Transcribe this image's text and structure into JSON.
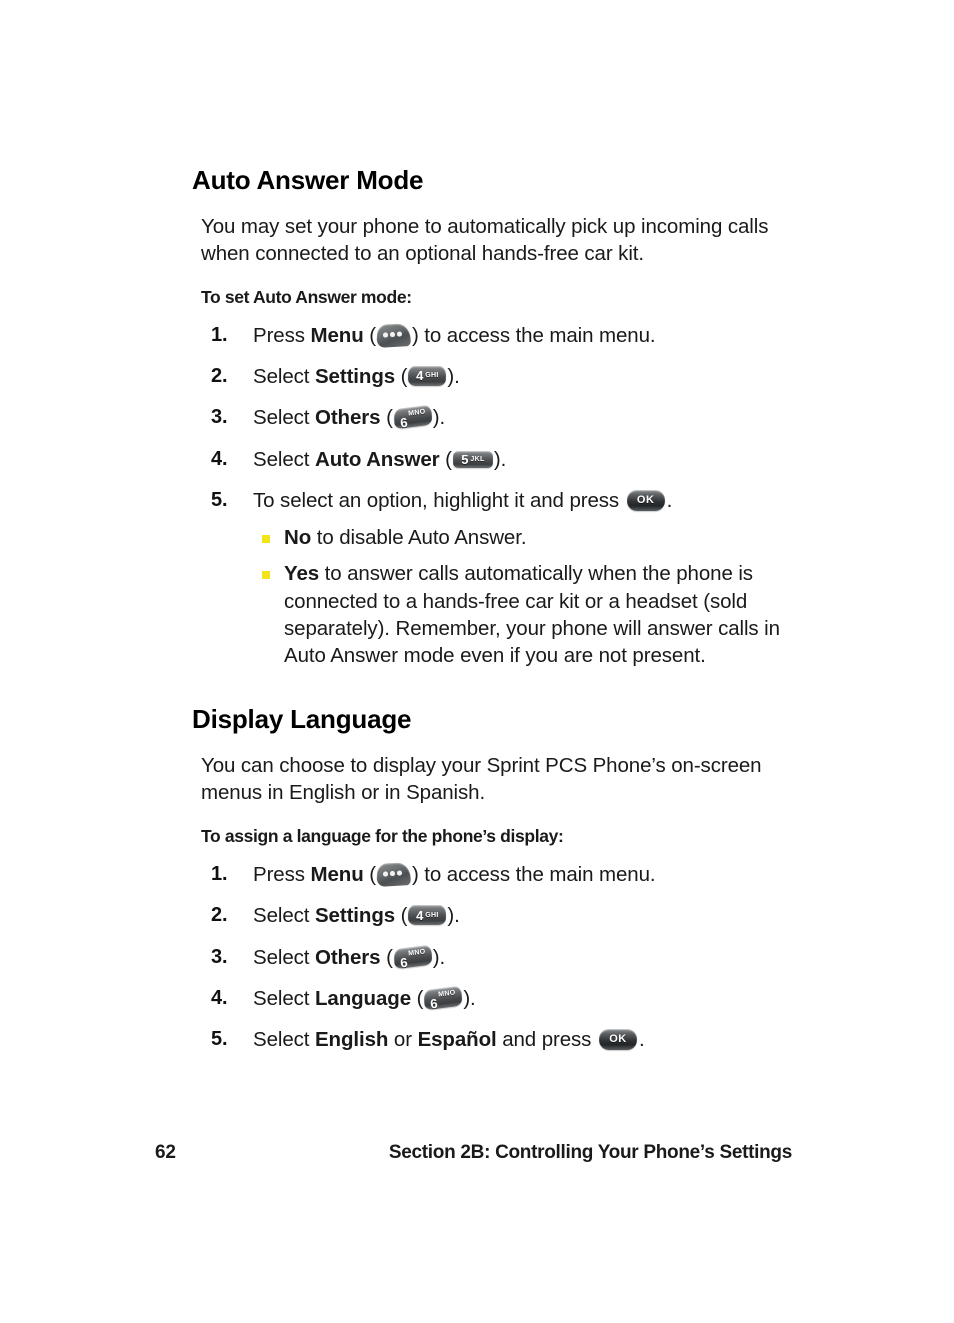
{
  "page": {
    "number": "62",
    "footer_section_title": "Section 2B: Controlling Your Phone’s Settings",
    "bullet_color": "#f2e31a",
    "text_color": "#1a1a1a",
    "background_color": "#ffffff"
  },
  "sections": [
    {
      "heading": "Auto Answer Mode",
      "body": "You may set your phone to automatically pick up incoming calls when connected to an optional hands-free car kit.",
      "sub_heading": "To set Auto Answer mode:",
      "steps": [
        {
          "num": "1.",
          "pre": "Press ",
          "bold": "Menu",
          "mid": " (",
          "icon": "menu-softkey-icon",
          "post": ") to access the main menu."
        },
        {
          "num": "2.",
          "pre": "Select ",
          "bold": "Settings",
          "mid": " (",
          "icon": "key-4-ghi-icon",
          "post": ")."
        },
        {
          "num": "3.",
          "pre": "Select ",
          "bold": "Others",
          "mid": " (",
          "icon": "key-6-mno-icon",
          "post": ")."
        },
        {
          "num": "4.",
          "pre": "Select ",
          "bold": "Auto Answer",
          "mid": " (",
          "icon": "key-5-jkl-icon",
          "post": ")."
        },
        {
          "num": "5.",
          "pre": "To select an option, highlight it and press ",
          "bold": "",
          "mid": "",
          "icon": "key-ok-icon",
          "post": "."
        }
      ],
      "sub_bullets": [
        {
          "bold": "No",
          "text": " to disable Auto Answer."
        },
        {
          "bold": "Yes",
          "text": " to answer calls automatically when the phone is connected to a hands-free car kit or a headset (sold separately). Remember, your phone will answer calls in Auto Answer mode even if you are not present."
        }
      ]
    },
    {
      "heading": "Display Language",
      "body": "You can choose to display your Sprint PCS Phone’s on-screen menus in English or in Spanish.",
      "sub_heading": "To assign a language for the phone’s display:",
      "steps": [
        {
          "num": "1.",
          "pre": "Press ",
          "bold": "Menu",
          "mid": " (",
          "icon": "menu-softkey-icon",
          "post": ") to access the main menu."
        },
        {
          "num": "2.",
          "pre": "Select ",
          "bold": "Settings",
          "mid": " (",
          "icon": "key-4-ghi-icon",
          "post": ")."
        },
        {
          "num": "3.",
          "pre": "Select ",
          "bold": "Others",
          "mid": " (",
          "icon": "key-6-mno-icon",
          "post": ")."
        },
        {
          "num": "4.",
          "pre": "Select ",
          "bold": "Language",
          "mid": " (",
          "icon": "key-6-mno-icon",
          "post": ")."
        },
        {
          "num": "5.",
          "pre": "Select ",
          "bold": "English",
          "mid": " or ",
          "bold2": "Español",
          "mid2": " and press ",
          "icon": "key-ok-icon",
          "post": "."
        }
      ],
      "sub_bullets": []
    }
  ],
  "key_icons": {
    "menu": {
      "dots": "3",
      "label": ""
    },
    "key4": {
      "digit": "4",
      "letters": "GHI"
    },
    "key5": {
      "digit": "5",
      "letters": "JKL"
    },
    "key6": {
      "digit": "6",
      "letters": "MNO"
    },
    "ok": {
      "label": "OK"
    }
  }
}
